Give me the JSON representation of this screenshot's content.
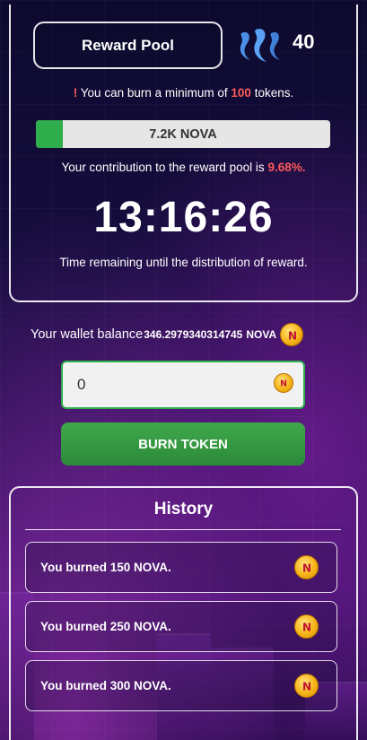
{
  "header": {
    "reward_pool_label": "Reward Pool",
    "steem_icon": "steem-logo-icon",
    "steem_count": "40"
  },
  "notice": {
    "bang": "!",
    "prefix": "You can burn a minimum of",
    "min_tokens": "100",
    "suffix": "tokens."
  },
  "pool": {
    "progress_label": "7.2K NOVA",
    "progress_fraction": 0.09,
    "progress_color": "#2fae4e"
  },
  "contribution": {
    "prefix": "Your contribution to the reward pool is",
    "percent": "9.68%."
  },
  "countdown": {
    "time": "13:16:26",
    "caption": "Time remaining until the distribution of reward."
  },
  "wallet": {
    "label": "Your wallet balance",
    "amount": "346.2979340314745",
    "unit": "NOVA",
    "coin_icon": "nova-coin-icon"
  },
  "burn_form": {
    "input_value": "0",
    "button_label": "BURN TOKEN",
    "accent": "#2fae4e"
  },
  "history": {
    "title": "History",
    "items": [
      {
        "text": "You burned 150 NOVA."
      },
      {
        "text": "You burned 250 NOVA."
      },
      {
        "text": "You burned 300 NOVA."
      }
    ]
  }
}
